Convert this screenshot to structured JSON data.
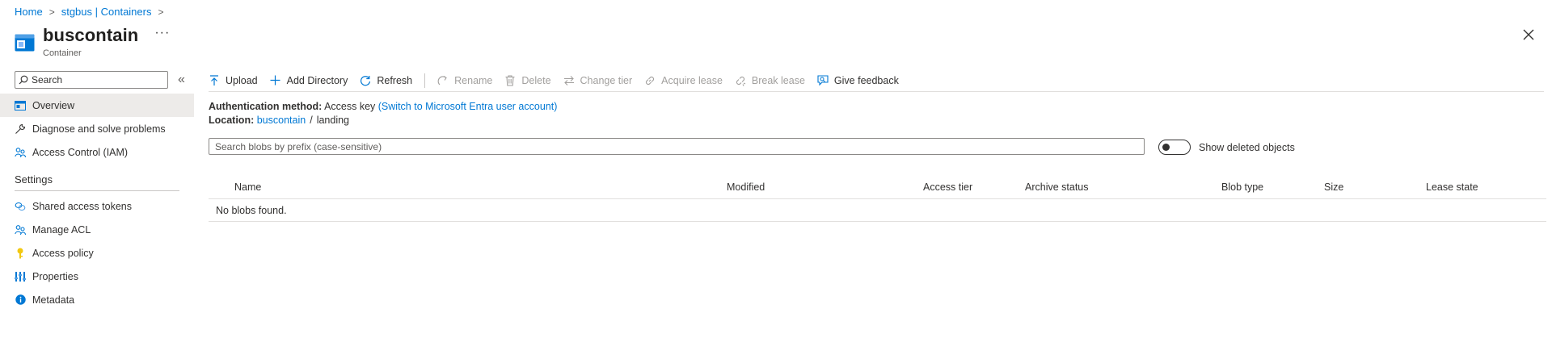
{
  "breadcrumb": {
    "items": [
      "Home",
      "stgbus | Containers"
    ],
    "separator": ">"
  },
  "header": {
    "title": "buscontain",
    "subtitle": "Container",
    "more_label": "···",
    "icon": "storage-container-icon",
    "close_icon": "close-icon"
  },
  "sidebar": {
    "search_placeholder": "Search",
    "collapse_label": "«",
    "items": [
      {
        "label": "Overview",
        "icon": "overview-icon",
        "active": true
      },
      {
        "label": "Diagnose and solve problems",
        "icon": "wrench-icon"
      },
      {
        "label": "Access Control (IAM)",
        "icon": "people-icon"
      }
    ],
    "settings_title": "Settings",
    "settings_items": [
      {
        "label": "Shared access tokens",
        "icon": "link-icon"
      },
      {
        "label": "Manage ACL",
        "icon": "people-icon"
      },
      {
        "label": "Access policy",
        "icon": "key-icon"
      },
      {
        "label": "Properties",
        "icon": "properties-icon"
      },
      {
        "label": "Metadata",
        "icon": "info-icon"
      }
    ]
  },
  "toolbar": {
    "upload": "Upload",
    "add_directory": "Add Directory",
    "refresh": "Refresh",
    "rename": "Rename",
    "delete": "Delete",
    "change_tier": "Change tier",
    "acquire_lease": "Acquire lease",
    "break_lease": "Break lease",
    "give_feedback": "Give feedback"
  },
  "info": {
    "auth_label": "Authentication method:",
    "auth_value": "Access key",
    "auth_link": "(Switch to Microsoft Entra user account)",
    "location_label": "Location:",
    "location_link": "buscontain",
    "location_sep": "/",
    "location_folder": "landing"
  },
  "blob_search": {
    "placeholder": "Search blobs by prefix (case-sensitive)"
  },
  "toggle": {
    "label": "Show deleted objects",
    "on": false
  },
  "table": {
    "columns": [
      "Name",
      "Modified",
      "Access tier",
      "Archive status",
      "Blob type",
      "Size",
      "Lease state"
    ],
    "empty_message": "No blobs found."
  },
  "colors": {
    "accent": "#0078d4",
    "text": "#323130",
    "disabled": "#a19f9d",
    "active_nav": "#edebe9"
  }
}
